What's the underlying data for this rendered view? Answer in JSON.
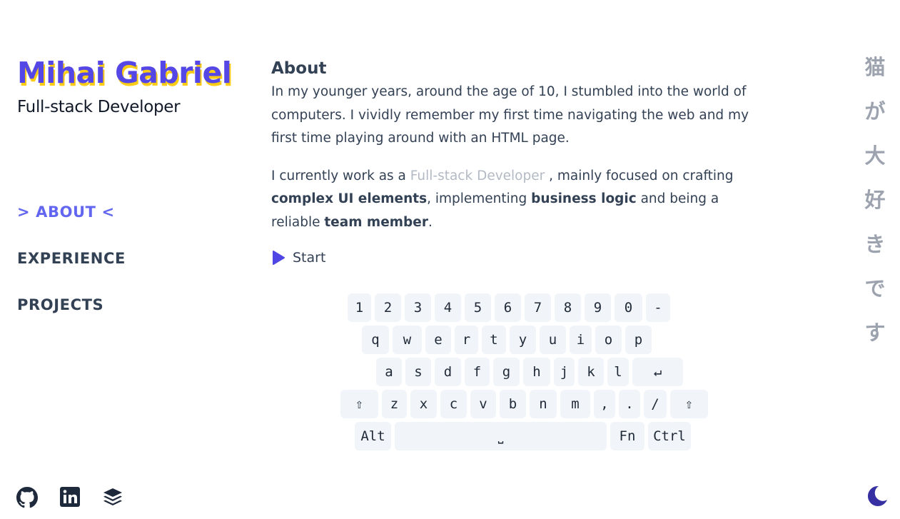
{
  "header": {
    "name": "Mihai Gabriel",
    "role": "Full-stack Developer"
  },
  "nav": {
    "about": "> ABOUT <",
    "experience": "EXPERIENCE",
    "projects": "PROJECTS"
  },
  "about": {
    "title": "About",
    "p1": "In my younger years, around the age of 10, I stumbled into the world of computers. I vividly remember my first time navigating the web and my first time playing around with an HTML page.",
    "p2_pre": "I currently work as a ",
    "p2_role": "Full-stack Developer",
    "p2_mid1": " , mainly focused on crafting ",
    "p2_b1": "complex UI elements",
    "p2_mid2": ", implementing ",
    "p2_b2": "business logic",
    "p2_mid3": " and being a reliable ",
    "p2_b3": "team member",
    "p2_end": "."
  },
  "start_label": "Start",
  "keyboard": {
    "row1": [
      "1",
      "2",
      "3",
      "4",
      "5",
      "6",
      "7",
      "8",
      "9",
      "0",
      "-"
    ],
    "row2": [
      "q",
      "w",
      "e",
      "r",
      "t",
      "y",
      "u",
      "i",
      "o",
      "p"
    ],
    "row3": [
      "a",
      "s",
      "d",
      "f",
      "g",
      "h",
      "j",
      "k",
      "l",
      "↵"
    ],
    "row4": [
      "⇧",
      "z",
      "x",
      "c",
      "v",
      "b",
      "n",
      "m",
      ",",
      ".",
      "/",
      "⇧"
    ],
    "row5": [
      "Alt",
      "⎵",
      "Fn",
      "Ctrl"
    ]
  },
  "kana": [
    "猫",
    "が",
    "大",
    "好",
    "き",
    "で",
    "す"
  ],
  "icons": {
    "social": [
      "github-icon",
      "linkedin-icon",
      "stackoverflow-icon"
    ],
    "theme": "moon-icon"
  },
  "colors": {
    "accent": "#5547e6",
    "shadow": "#facc15",
    "key_bg": "#f1f5f9",
    "play": "#4f46e5"
  }
}
